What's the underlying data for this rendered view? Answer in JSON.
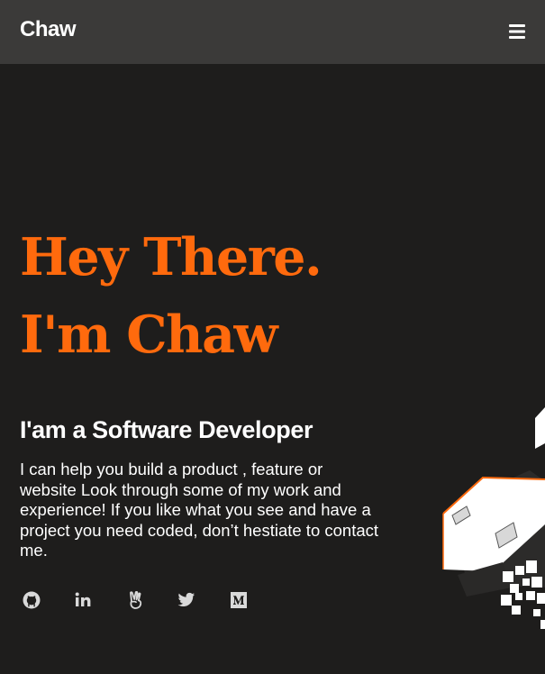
{
  "nav": {
    "brand": "Chaw",
    "menu_icon": "hamburger-menu-icon"
  },
  "hero": {
    "greeting_line1": "Hey There.",
    "greeting_line2": "I'm Chaw",
    "subtitle": "I'am a Software Developer",
    "description": "I can help you build a product , feature or website Look through some of my work and experience! If you like what you see and have a project you need coded, don’t hestiate to contact me."
  },
  "social_links": [
    {
      "icon": "github-icon"
    },
    {
      "icon": "linkedin-icon"
    },
    {
      "icon": "angellist-icon"
    },
    {
      "icon": "twitter-icon"
    },
    {
      "icon": "medium-icon"
    }
  ],
  "colors": {
    "accent": "#ff6a0d",
    "navbar_bg": "#3b3a39",
    "page_bg": "#1e1d1c",
    "text": "#ffffff",
    "icon": "#d9d9d9"
  }
}
